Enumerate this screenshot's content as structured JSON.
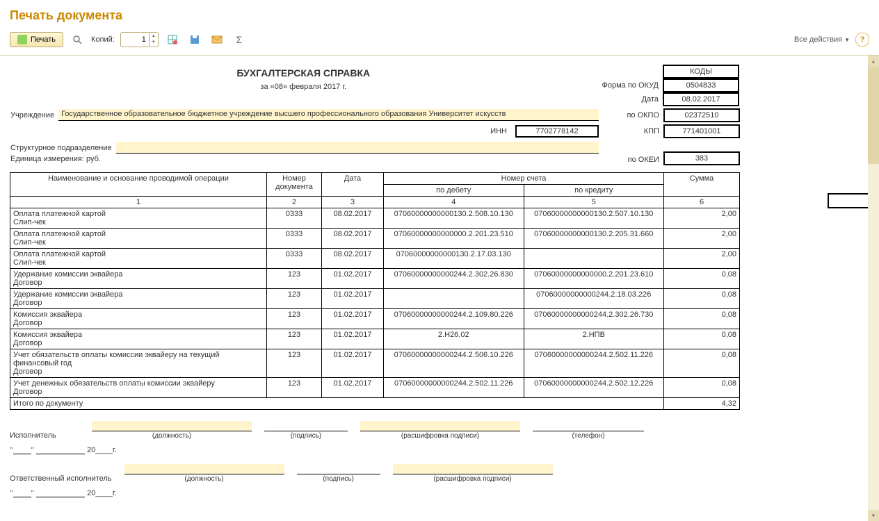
{
  "page_title": "Печать документа",
  "toolbar": {
    "print_label": "Печать",
    "copies_label": "Копий:",
    "copies_value": "1",
    "all_actions": "Все действия"
  },
  "doc": {
    "title": "БУХГАЛТЕРСКАЯ СПРАВКА",
    "subtitle": "за «08» февраля 2017 г.",
    "codes_header": "КОДЫ",
    "code_labels": {
      "okud": "Форма по ОКУД",
      "date": "Дата",
      "okpo": "по ОКПО",
      "kpp": "КПП",
      "okei": "по ОКЕИ"
    },
    "codes": {
      "okud": "0504833",
      "date": "08.02.2017",
      "okpo": "02372510",
      "kpp": "771401001",
      "okei": "383"
    },
    "org_label": "Учреждение",
    "org": "Государственное образовательное бюджетное учреждение высшего профессионального образования Университет искусств",
    "inn_label": "ИНН",
    "inn": "7702778142",
    "division_label": "Структурное подразделение",
    "division": "",
    "unit_label": "Единица измерения: руб.",
    "table": {
      "h_name": "Наименование и основание проводимой операции",
      "h_docnum": "Номер документа",
      "h_date": "Дата",
      "h_acc": "Номер счета",
      "h_debit": "по дебету",
      "h_credit": "по кредиту",
      "h_sum": "Сумма",
      "idx": [
        "1",
        "2",
        "3",
        "4",
        "5",
        "6"
      ],
      "rows": [
        {
          "name": "Оплата платежной картой\nСлип-чек",
          "num": "0333",
          "date": "08.02.2017",
          "debit": "07060000000000130.2.508.10.130",
          "credit": "07060000000000130.2.507.10.130",
          "sum": "2,00"
        },
        {
          "name": "Оплата платежной картой\nСлип-чек",
          "num": "0333",
          "date": "08.02.2017",
          "debit": "07060000000000000.2.201.23.510",
          "credit": "07060000000000130.2.205.31.660",
          "sum": "2,00"
        },
        {
          "name": "Оплата платежной картой\nСлип-чек",
          "num": "0333",
          "date": "08.02.2017",
          "debit": "07060000000000130.2.17.03.130",
          "credit": "",
          "sum": "2,00"
        },
        {
          "name": "Удержание комиссии эквайера\nДоговор",
          "num": "123",
          "date": "01.02.2017",
          "debit": "07060000000000244.2.302.26.830",
          "credit": "07060000000000000.2.201.23.610",
          "sum": "0,08"
        },
        {
          "name": "Удержание комиссии эквайера\nДоговор",
          "num": "123",
          "date": "01.02.2017",
          "debit": "",
          "credit": "07060000000000244.2.18.03.226",
          "sum": "0,08"
        },
        {
          "name": "Комиссия эквайера\nДоговор",
          "num": "123",
          "date": "01.02.2017",
          "debit": "07060000000000244.2.109.80.226",
          "credit": "07060000000000244.2.302.26.730",
          "sum": "0,08"
        },
        {
          "name": "Комиссия эквайера\nДоговор",
          "num": "123",
          "date": "01.02.2017",
          "debit": "2.Н26.02",
          "credit": "2.НПВ",
          "sum": "0,08"
        },
        {
          "name": "Учет обязательств оплаты комиссии эквайеру на текущий финансовый год\nДоговор",
          "num": "123",
          "date": "01.02.2017",
          "debit": "07060000000000244.2.506.10.226",
          "credit": "07060000000000244.2.502.11.226",
          "sum": "0,08"
        },
        {
          "name": "Учет денежных обязательств оплаты комиссии эквайеру\nДоговор",
          "num": "123",
          "date": "01.02.2017",
          "debit": "07060000000000244.2.502.11.226",
          "credit": "07060000000000244.2.502.12.226",
          "sum": "0,08"
        }
      ],
      "total_label": "Итого по документу",
      "total": "4,32"
    },
    "sign": {
      "exec": "Исполнитель",
      "resp": "Ответственный исполнитель",
      "cap_post": "(должность)",
      "cap_sign": "(подпись)",
      "cap_dec": "(расшифровка подписи)",
      "cap_phone": "(телефон)",
      "year_frag": "20____г."
    }
  }
}
